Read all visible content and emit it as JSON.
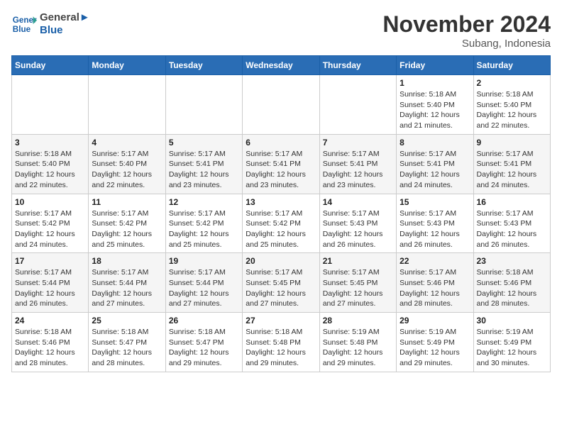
{
  "header": {
    "logo_line1": "General",
    "logo_line2": "Blue",
    "month_year": "November 2024",
    "location": "Subang, Indonesia"
  },
  "weekdays": [
    "Sunday",
    "Monday",
    "Tuesday",
    "Wednesday",
    "Thursday",
    "Friday",
    "Saturday"
  ],
  "weeks": [
    [
      {
        "day": "",
        "info": ""
      },
      {
        "day": "",
        "info": ""
      },
      {
        "day": "",
        "info": ""
      },
      {
        "day": "",
        "info": ""
      },
      {
        "day": "",
        "info": ""
      },
      {
        "day": "1",
        "info": "Sunrise: 5:18 AM\nSunset: 5:40 PM\nDaylight: 12 hours\nand 21 minutes."
      },
      {
        "day": "2",
        "info": "Sunrise: 5:18 AM\nSunset: 5:40 PM\nDaylight: 12 hours\nand 22 minutes."
      }
    ],
    [
      {
        "day": "3",
        "info": "Sunrise: 5:18 AM\nSunset: 5:40 PM\nDaylight: 12 hours\nand 22 minutes."
      },
      {
        "day": "4",
        "info": "Sunrise: 5:17 AM\nSunset: 5:40 PM\nDaylight: 12 hours\nand 22 minutes."
      },
      {
        "day": "5",
        "info": "Sunrise: 5:17 AM\nSunset: 5:41 PM\nDaylight: 12 hours\nand 23 minutes."
      },
      {
        "day": "6",
        "info": "Sunrise: 5:17 AM\nSunset: 5:41 PM\nDaylight: 12 hours\nand 23 minutes."
      },
      {
        "day": "7",
        "info": "Sunrise: 5:17 AM\nSunset: 5:41 PM\nDaylight: 12 hours\nand 23 minutes."
      },
      {
        "day": "8",
        "info": "Sunrise: 5:17 AM\nSunset: 5:41 PM\nDaylight: 12 hours\nand 24 minutes."
      },
      {
        "day": "9",
        "info": "Sunrise: 5:17 AM\nSunset: 5:41 PM\nDaylight: 12 hours\nand 24 minutes."
      }
    ],
    [
      {
        "day": "10",
        "info": "Sunrise: 5:17 AM\nSunset: 5:42 PM\nDaylight: 12 hours\nand 24 minutes."
      },
      {
        "day": "11",
        "info": "Sunrise: 5:17 AM\nSunset: 5:42 PM\nDaylight: 12 hours\nand 25 minutes."
      },
      {
        "day": "12",
        "info": "Sunrise: 5:17 AM\nSunset: 5:42 PM\nDaylight: 12 hours\nand 25 minutes."
      },
      {
        "day": "13",
        "info": "Sunrise: 5:17 AM\nSunset: 5:42 PM\nDaylight: 12 hours\nand 25 minutes."
      },
      {
        "day": "14",
        "info": "Sunrise: 5:17 AM\nSunset: 5:43 PM\nDaylight: 12 hours\nand 26 minutes."
      },
      {
        "day": "15",
        "info": "Sunrise: 5:17 AM\nSunset: 5:43 PM\nDaylight: 12 hours\nand 26 minutes."
      },
      {
        "day": "16",
        "info": "Sunrise: 5:17 AM\nSunset: 5:43 PM\nDaylight: 12 hours\nand 26 minutes."
      }
    ],
    [
      {
        "day": "17",
        "info": "Sunrise: 5:17 AM\nSunset: 5:44 PM\nDaylight: 12 hours\nand 26 minutes."
      },
      {
        "day": "18",
        "info": "Sunrise: 5:17 AM\nSunset: 5:44 PM\nDaylight: 12 hours\nand 27 minutes."
      },
      {
        "day": "19",
        "info": "Sunrise: 5:17 AM\nSunset: 5:44 PM\nDaylight: 12 hours\nand 27 minutes."
      },
      {
        "day": "20",
        "info": "Sunrise: 5:17 AM\nSunset: 5:45 PM\nDaylight: 12 hours\nand 27 minutes."
      },
      {
        "day": "21",
        "info": "Sunrise: 5:17 AM\nSunset: 5:45 PM\nDaylight: 12 hours\nand 27 minutes."
      },
      {
        "day": "22",
        "info": "Sunrise: 5:17 AM\nSunset: 5:46 PM\nDaylight: 12 hours\nand 28 minutes."
      },
      {
        "day": "23",
        "info": "Sunrise: 5:18 AM\nSunset: 5:46 PM\nDaylight: 12 hours\nand 28 minutes."
      }
    ],
    [
      {
        "day": "24",
        "info": "Sunrise: 5:18 AM\nSunset: 5:46 PM\nDaylight: 12 hours\nand 28 minutes."
      },
      {
        "day": "25",
        "info": "Sunrise: 5:18 AM\nSunset: 5:47 PM\nDaylight: 12 hours\nand 28 minutes."
      },
      {
        "day": "26",
        "info": "Sunrise: 5:18 AM\nSunset: 5:47 PM\nDaylight: 12 hours\nand 29 minutes."
      },
      {
        "day": "27",
        "info": "Sunrise: 5:18 AM\nSunset: 5:48 PM\nDaylight: 12 hours\nand 29 minutes."
      },
      {
        "day": "28",
        "info": "Sunrise: 5:19 AM\nSunset: 5:48 PM\nDaylight: 12 hours\nand 29 minutes."
      },
      {
        "day": "29",
        "info": "Sunrise: 5:19 AM\nSunset: 5:49 PM\nDaylight: 12 hours\nand 29 minutes."
      },
      {
        "day": "30",
        "info": "Sunrise: 5:19 AM\nSunset: 5:49 PM\nDaylight: 12 hours\nand 30 minutes."
      }
    ]
  ]
}
